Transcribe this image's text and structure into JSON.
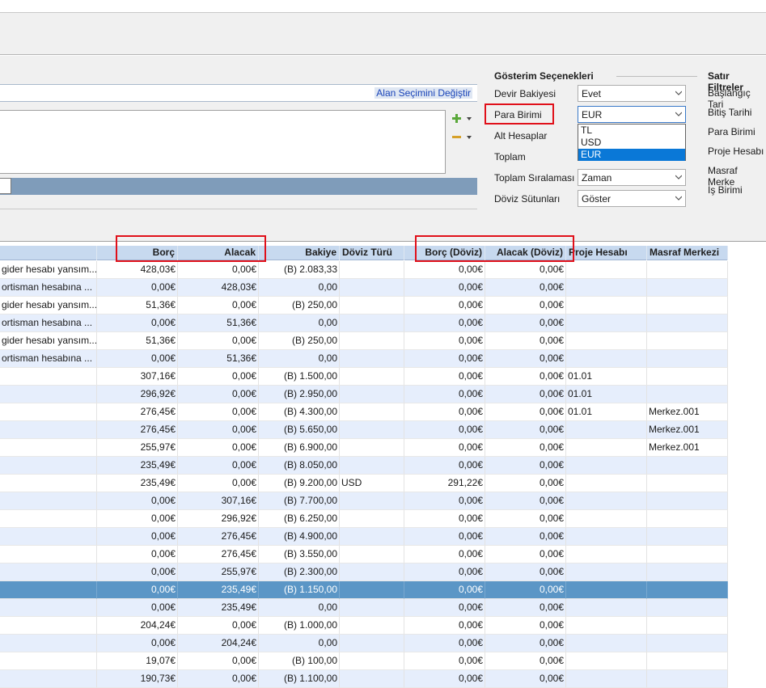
{
  "link_change_field_selection": "Alan Seçimini Değiştir",
  "display_options": {
    "title": "Gösterim Seçenekleri",
    "rows": [
      {
        "label": "Devir Bakiyesi",
        "value": "Evet"
      },
      {
        "label": "Para Birimi",
        "value": "EUR"
      },
      {
        "label": "Alt Hesaplar",
        "value": ""
      },
      {
        "label": "Toplam",
        "value": ""
      },
      {
        "label": "Toplam Sıralaması",
        "value": "Zaman"
      },
      {
        "label": "Döviz Sütunları",
        "value": "Göster"
      }
    ],
    "currency_options": [
      "TL",
      "USD",
      "EUR"
    ],
    "currency_selected": "EUR"
  },
  "row_filters": {
    "title": "Satır Filtreler",
    "items": [
      "Başlangıç Tari",
      "Bitiş Tarihi",
      "Para Birimi",
      "Proje Hesabı",
      "Masraf Merke",
      "İş Birimi"
    ]
  },
  "columns": [
    "Borç",
    "Alacak",
    "Bakiye",
    "Döviz Türü",
    "Borç (Döviz)",
    "Alacak (Döviz)",
    "Proje Hesabı",
    "Masraf Merkezi"
  ],
  "rows": [
    {
      "desc": " gider hesabı yansım...",
      "borc": "428,03€",
      "alacak": "0,00€",
      "bakiye": "(B) 2.083,33",
      "doviz": "",
      "borc_d": "0,00€",
      "alacak_d": "0,00€",
      "proje": "",
      "masraf": ""
    },
    {
      "desc": "ortisman hesabına ...",
      "borc": "0,00€",
      "alacak": "428,03€",
      "bakiye": "0,00",
      "doviz": "",
      "borc_d": "0,00€",
      "alacak_d": "0,00€",
      "proje": "",
      "masraf": ""
    },
    {
      "desc": " gider hesabı yansım...",
      "borc": "51,36€",
      "alacak": "0,00€",
      "bakiye": "(B) 250,00",
      "doviz": "",
      "borc_d": "0,00€",
      "alacak_d": "0,00€",
      "proje": "",
      "masraf": ""
    },
    {
      "desc": "ortisman hesabına ...",
      "borc": "0,00€",
      "alacak": "51,36€",
      "bakiye": "0,00",
      "doviz": "",
      "borc_d": "0,00€",
      "alacak_d": "0,00€",
      "proje": "",
      "masraf": ""
    },
    {
      "desc": " gider hesabı yansım...",
      "borc": "51,36€",
      "alacak": "0,00€",
      "bakiye": "(B) 250,00",
      "doviz": "",
      "borc_d": "0,00€",
      "alacak_d": "0,00€",
      "proje": "",
      "masraf": ""
    },
    {
      "desc": "ortisman hesabına ...",
      "borc": "0,00€",
      "alacak": "51,36€",
      "bakiye": "0,00",
      "doviz": "",
      "borc_d": "0,00€",
      "alacak_d": "0,00€",
      "proje": "",
      "masraf": ""
    },
    {
      "desc": "",
      "borc": "307,16€",
      "alacak": "0,00€",
      "bakiye": "(B) 1.500,00",
      "doviz": "",
      "borc_d": "0,00€",
      "alacak_d": "0,00€",
      "proje": "01.01",
      "masraf": ""
    },
    {
      "desc": "",
      "borc": "296,92€",
      "alacak": "0,00€",
      "bakiye": "(B) 2.950,00",
      "doviz": "",
      "borc_d": "0,00€",
      "alacak_d": "0,00€",
      "proje": "01.01",
      "masraf": ""
    },
    {
      "desc": "",
      "borc": "276,45€",
      "alacak": "0,00€",
      "bakiye": "(B) 4.300,00",
      "doviz": "",
      "borc_d": "0,00€",
      "alacak_d": "0,00€",
      "proje": "01.01",
      "masraf": "Merkez.001"
    },
    {
      "desc": "",
      "borc": "276,45€",
      "alacak": "0,00€",
      "bakiye": "(B) 5.650,00",
      "doviz": "",
      "borc_d": "0,00€",
      "alacak_d": "0,00€",
      "proje": "",
      "masraf": "Merkez.001"
    },
    {
      "desc": "",
      "borc": "255,97€",
      "alacak": "0,00€",
      "bakiye": "(B) 6.900,00",
      "doviz": "",
      "borc_d": "0,00€",
      "alacak_d": "0,00€",
      "proje": "",
      "masraf": "Merkez.001"
    },
    {
      "desc": "",
      "borc": "235,49€",
      "alacak": "0,00€",
      "bakiye": "(B) 8.050,00",
      "doviz": "",
      "borc_d": "0,00€",
      "alacak_d": "0,00€",
      "proje": "",
      "masraf": ""
    },
    {
      "desc": "",
      "borc": "235,49€",
      "alacak": "0,00€",
      "bakiye": "(B) 9.200,00",
      "doviz": "USD",
      "borc_d": "291,22€",
      "alacak_d": "0,00€",
      "proje": "",
      "masraf": ""
    },
    {
      "desc": "",
      "borc": "0,00€",
      "alacak": "307,16€",
      "bakiye": "(B) 7.700,00",
      "doviz": "",
      "borc_d": "0,00€",
      "alacak_d": "0,00€",
      "proje": "",
      "masraf": ""
    },
    {
      "desc": "",
      "borc": "0,00€",
      "alacak": "296,92€",
      "bakiye": "(B) 6.250,00",
      "doviz": "",
      "borc_d": "0,00€",
      "alacak_d": "0,00€",
      "proje": "",
      "masraf": ""
    },
    {
      "desc": "",
      "borc": "0,00€",
      "alacak": "276,45€",
      "bakiye": "(B) 4.900,00",
      "doviz": "",
      "borc_d": "0,00€",
      "alacak_d": "0,00€",
      "proje": "",
      "masraf": ""
    },
    {
      "desc": "",
      "borc": "0,00€",
      "alacak": "276,45€",
      "bakiye": "(B) 3.550,00",
      "doviz": "",
      "borc_d": "0,00€",
      "alacak_d": "0,00€",
      "proje": "",
      "masraf": ""
    },
    {
      "desc": "",
      "borc": "0,00€",
      "alacak": "255,97€",
      "bakiye": "(B) 2.300,00",
      "doviz": "",
      "borc_d": "0,00€",
      "alacak_d": "0,00€",
      "proje": "",
      "masraf": ""
    },
    {
      "desc": "",
      "borc": "0,00€",
      "alacak": "235,49€",
      "bakiye": "(B) 1.150,00",
      "doviz": "",
      "borc_d": "0,00€",
      "alacak_d": "0,00€",
      "proje": "",
      "masraf": "",
      "selected": true
    },
    {
      "desc": "",
      "borc": "0,00€",
      "alacak": "235,49€",
      "bakiye": "0,00",
      "doviz": "",
      "borc_d": "0,00€",
      "alacak_d": "0,00€",
      "proje": "",
      "masraf": ""
    },
    {
      "desc": "",
      "borc": "204,24€",
      "alacak": "0,00€",
      "bakiye": "(B) 1.000,00",
      "doviz": "",
      "borc_d": "0,00€",
      "alacak_d": "0,00€",
      "proje": "",
      "masraf": ""
    },
    {
      "desc": "",
      "borc": "0,00€",
      "alacak": "204,24€",
      "bakiye": "0,00",
      "doviz": "",
      "borc_d": "0,00€",
      "alacak_d": "0,00€",
      "proje": "",
      "masraf": ""
    },
    {
      "desc": "",
      "borc": "19,07€",
      "alacak": "0,00€",
      "bakiye": "(B) 100,00",
      "doviz": "",
      "borc_d": "0,00€",
      "alacak_d": "0,00€",
      "proje": "",
      "masraf": ""
    },
    {
      "desc": "",
      "borc": "190,73€",
      "alacak": "0,00€",
      "bakiye": "(B) 1.100,00",
      "doviz": "",
      "borc_d": "0,00€",
      "alacak_d": "0,00€",
      "proje": "",
      "masraf": ""
    }
  ],
  "colors": {
    "highlight_box": "#e0101a",
    "header_bg": "#c7d9ef",
    "alt_row": "#e6eefc",
    "selected_row": "#5b96c6",
    "dropdown_selected": "#0a78d7"
  },
  "icons": [
    "add-icon",
    "remove-icon",
    "dropdown-arrow-icon",
    "chevron-down-icon"
  ]
}
